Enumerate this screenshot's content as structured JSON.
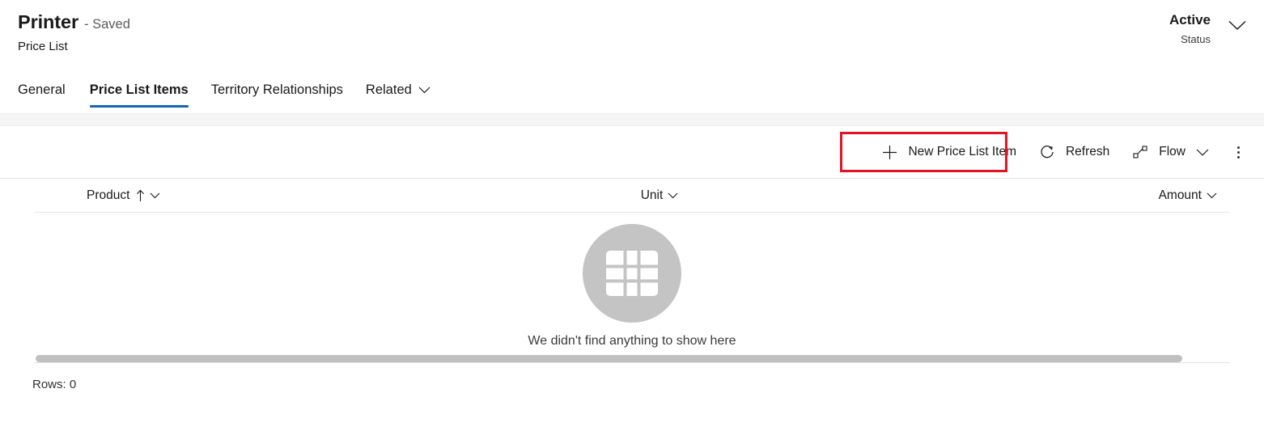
{
  "header": {
    "record_title": "Printer",
    "saved_state": "- Saved",
    "entity_name": "Price List",
    "status_value": "Active",
    "status_label": "Status",
    "status_chevron_icon": "chevron-down-icon"
  },
  "tabs": [
    {
      "label": "General",
      "active": false
    },
    {
      "label": "Price List Items",
      "active": true
    },
    {
      "label": "Territory Relationships",
      "active": false
    },
    {
      "label": "Related",
      "active": false,
      "chevron_icon": "chevron-down-icon"
    }
  ],
  "command_bar": {
    "new_item_label": "New Price List Item",
    "new_item_icon": "plus-icon",
    "refresh_label": "Refresh",
    "refresh_icon": "refresh-circular-arrow-icon",
    "flow_label": "Flow",
    "flow_icon": "flow-branch-icon",
    "flow_chevron_icon": "chevron-down-icon",
    "overflow_icon": "more-vertical-ellipsis-icon",
    "highlight_color": "#e81123",
    "highlight_target": "new_item_label"
  },
  "grid": {
    "columns": [
      {
        "label": "Product",
        "sort_icon": "sort-ascending-arrow-icon",
        "chevron_icon": "chevron-down-icon",
        "align": "left"
      },
      {
        "label": "Unit",
        "chevron_icon": "chevron-down-icon",
        "align": "left"
      },
      {
        "label": "Amount",
        "chevron_icon": "chevron-down-icon",
        "align": "right"
      }
    ],
    "rows": [],
    "empty_state": {
      "icon": "table-grid-icon",
      "message": "We didn't find anything to show here"
    },
    "footer_rows_label": "Rows: 0"
  },
  "theme": {
    "accent": "#1267b4",
    "text_primary": "#1b1a19",
    "text_secondary": "#5c5c5c",
    "empty_circle": "#c4c4c4",
    "divider": "#e1e1e1"
  }
}
